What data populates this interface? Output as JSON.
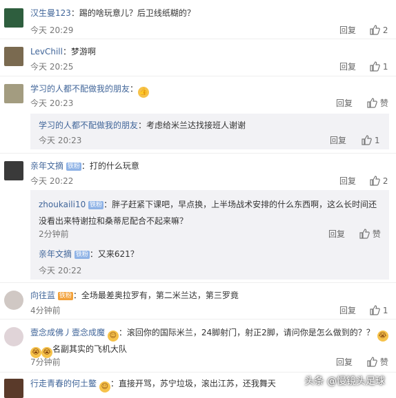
{
  "ui": {
    "reply_label": "回复",
    "like_label_text": "赞"
  },
  "comments": [
    {
      "user": "汉生曼123",
      "text": "踢的啥玩意儿？后卫线纸糊的？",
      "time": "今天 20:29",
      "likes": "2"
    },
    {
      "user": "LevChill",
      "text": "梦游啊",
      "time": "今天 20:25",
      "likes": "1"
    },
    {
      "user": "学习的人都不配做我的朋友",
      "text": "",
      "time": "今天 20:23",
      "likes": "赞"
    },
    {
      "user": "学习的人都不配做我的朋友",
      "text": "：考虑给米兰达找接班人谢谢",
      "time": "今天 20:23",
      "likes": "1"
    },
    {
      "user": "亲年文摘",
      "badge": "铁粉",
      "text": "：打的什么玩意",
      "time": "今天 20:22",
      "likes": "2"
    },
    {
      "user": "zhoukaili10",
      "badge": "铁粉",
      "text": "：胖子赶紧下课吧，早点换，上半场战术安排的什么东西啊，这么长时间还",
      "text2": "没看出来特谢拉和桑蒂尼配合不起来嘛？",
      "time": "2分钟前",
      "likes": "赞"
    },
    {
      "user": "亲年文摘",
      "badge": "铁粉",
      "text": "：又来621？",
      "time": "今天 20:22",
      "likes": ""
    },
    {
      "user": "向往蓝",
      "badge": "铁粉",
      "text": "：全场最差奥拉罗有，第二米兰达，第三罗竟",
      "time": "4分钟前",
      "likes": "1"
    },
    {
      "user": "壹念成佛丿壹念成魔",
      "text": "：滚回你的国际米兰，24脚射门，射正2脚，请问你是怎么做到的？？",
      "text2": "名副其实的飞机大队",
      "time": "7分钟前",
      "likes": "赞"
    },
    {
      "user": "行走青春的何土鳖",
      "text": "：直接开骂，苏宁垃圾，滚出江苏，还我舞天",
      "time": "",
      "likes": ""
    }
  ],
  "watermark": "头条 @慢镜头足球"
}
